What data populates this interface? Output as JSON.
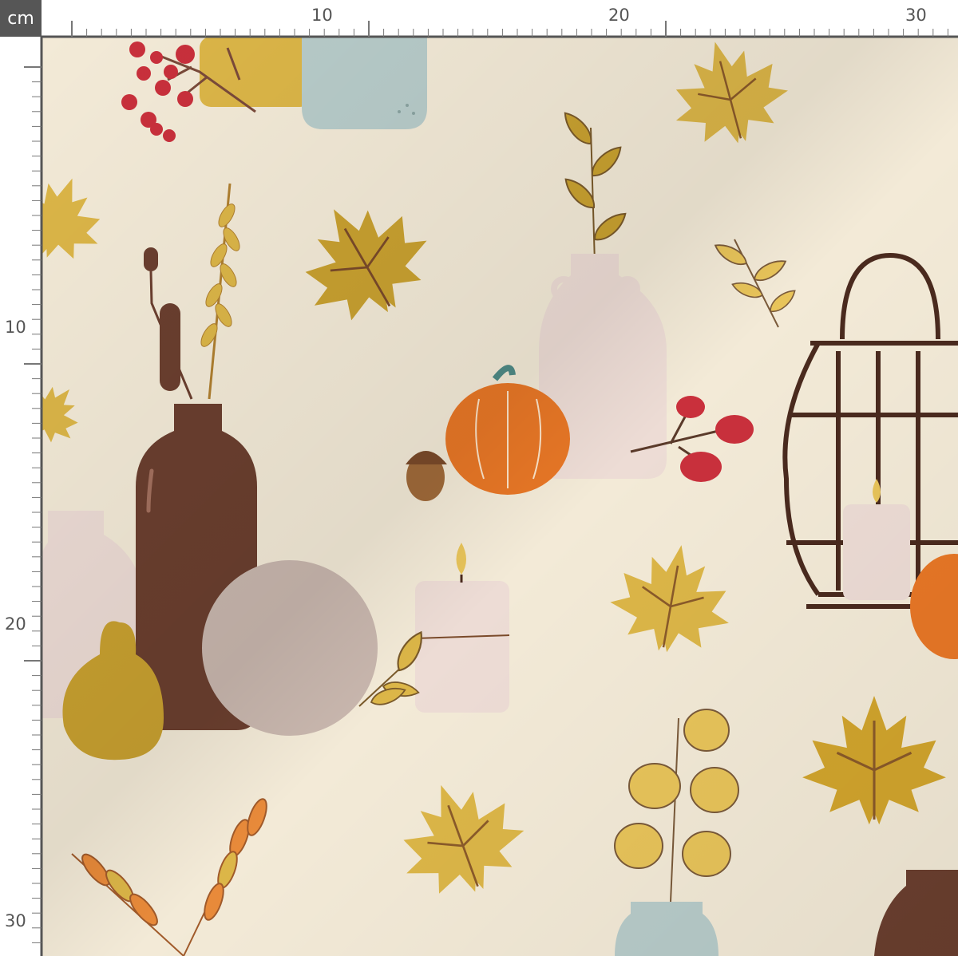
{
  "ruler": {
    "unit": "cm",
    "top_labels": [
      "10",
      "20",
      "30"
    ],
    "left_labels": [
      "10",
      "20",
      "30"
    ]
  },
  "palette": {
    "background": "#f3ead7",
    "mustard": "#c9a130",
    "gold": "#dcb648",
    "pumpkin": "#e87726",
    "brown": "#6b3f2f",
    "rose_vase": "#eddcd5",
    "taupe_vase": "#c9b7ae",
    "blue_jar": "#b8ccca",
    "berry": "#c9303c",
    "lantern": "#4a2a1e"
  },
  "motifs": [
    "maple-leaf",
    "leaf-branch",
    "vase",
    "pumpkin",
    "acorn",
    "pear",
    "candle",
    "lantern",
    "red-berries",
    "wheat",
    "cattail"
  ]
}
